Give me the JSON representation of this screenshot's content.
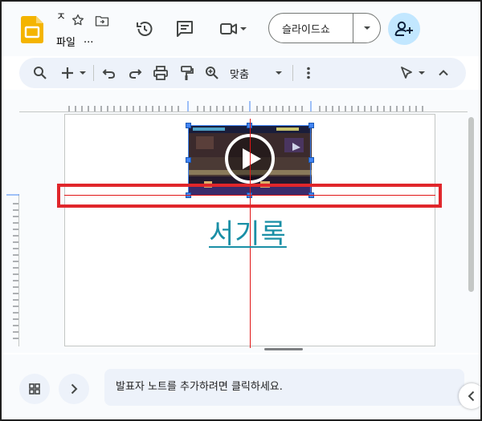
{
  "window": {
    "title_short": "ㅈ",
    "menu": [
      {
        "label": "파일"
      },
      {
        "label": "..."
      }
    ]
  },
  "header": {
    "slideshow_label": "슬라이드쇼",
    "icons": [
      "slides-logo-icon",
      "star-icon",
      "move-to-folder-icon",
      "history-icon",
      "comment-icon",
      "meet-video-icon",
      "share-add-person-icon"
    ]
  },
  "toolbar": {
    "zoom_label": "맞춤"
  },
  "slide": {
    "link_text": "서기록",
    "video_thumbnail": "game-video-thumbnail",
    "link_color": "#1a8fa6"
  },
  "notes": {
    "placeholder": "발표자 노트를 추가하려면 클릭하세요."
  },
  "colors": {
    "accent_blue": "#4285f4",
    "highlight_red": "#e0262b",
    "guide_red": "#e01616",
    "slides_yellow": "#f4b400",
    "share_bg": "#c2e7ff"
  }
}
